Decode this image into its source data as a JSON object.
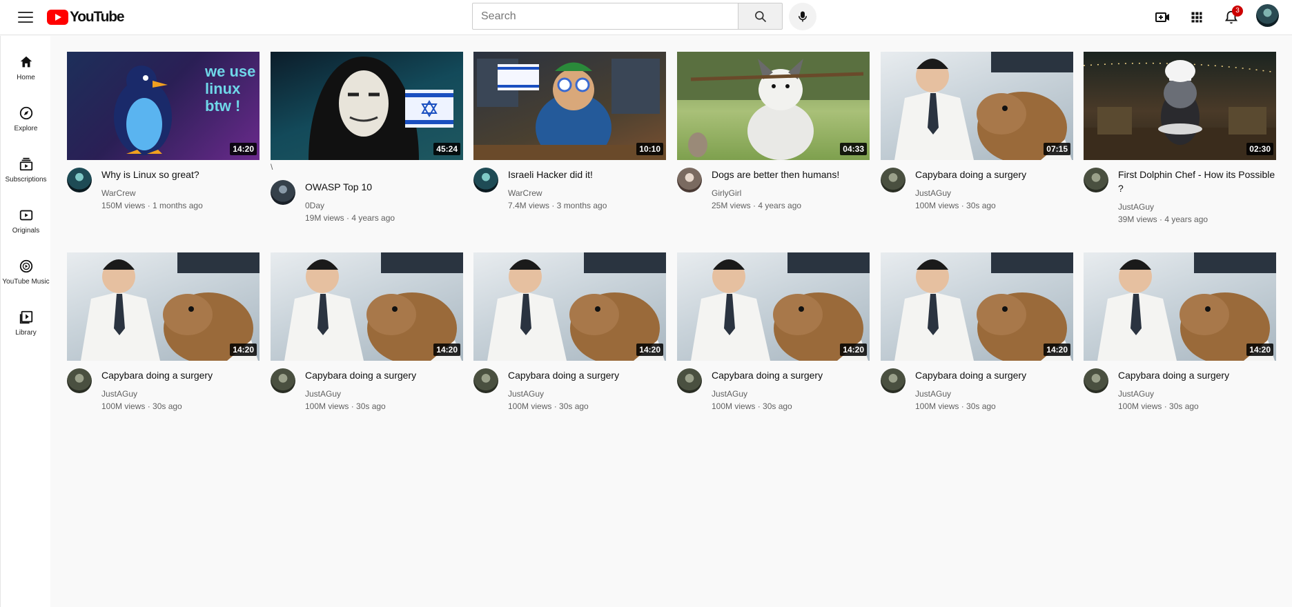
{
  "header": {
    "logo_text": "YouTube",
    "search_placeholder": "Search",
    "notification_count": "3"
  },
  "sidebar": {
    "items": [
      {
        "label": "Home",
        "icon": "home-icon"
      },
      {
        "label": "Explore",
        "icon": "compass-icon"
      },
      {
        "label": "Subscriptions",
        "icon": "subscriptions-icon"
      },
      {
        "label": "Originals",
        "icon": "originals-icon"
      },
      {
        "label": "YouTube Music",
        "icon": "music-icon"
      },
      {
        "label": "Library",
        "icon": "library-icon"
      }
    ]
  },
  "videos": [
    {
      "title": "Why is Linux so great?",
      "channel": "WarCrew",
      "meta": "150M views · 1 months ago",
      "duration": "14:20",
      "thumb_text": "we use linux btw !"
    },
    {
      "title": "OWASP Top 10",
      "channel": "0Day",
      "meta": "19M views · 4 years ago",
      "duration": "45:24",
      "stray": "\\"
    },
    {
      "title": "Israeli Hacker did it!",
      "channel": "WarCrew",
      "meta": "7.4M views · 3 months ago",
      "duration": "10:10"
    },
    {
      "title": "Dogs are better then humans!",
      "channel": "GirlyGirl",
      "meta": "25M views · 4 years ago",
      "duration": "04:33"
    },
    {
      "title": "Capybara doing a surgery",
      "channel": "JustAGuy",
      "meta": "100M views · 30s ago",
      "duration": "07:15"
    },
    {
      "title": "First Dolphin Chef - How its Possible ?",
      "channel": "JustAGuy",
      "meta": "39M views · 4 years ago",
      "duration": "02:30"
    },
    {
      "title": "Capybara doing a surgery",
      "channel": "JustAGuy",
      "meta": "100M views · 30s ago",
      "duration": "14:20"
    },
    {
      "title": "Capybara doing a surgery",
      "channel": "JustAGuy",
      "meta": "100M views · 30s ago",
      "duration": "14:20"
    },
    {
      "title": "Capybara doing a surgery",
      "channel": "JustAGuy",
      "meta": "100M views · 30s ago",
      "duration": "14:20"
    },
    {
      "title": "Capybara doing a surgery",
      "channel": "JustAGuy",
      "meta": "100M views · 30s ago",
      "duration": "14:20"
    },
    {
      "title": "Capybara doing a surgery",
      "channel": "JustAGuy",
      "meta": "100M views · 30s ago",
      "duration": "14:20"
    },
    {
      "title": "Capybara doing a surgery",
      "channel": "JustAGuy",
      "meta": "100M views · 30s ago",
      "duration": "14:20"
    }
  ],
  "colors": {
    "brand_red": "#ff0000",
    "badge_red": "#cc0000",
    "background": "#f9f9f9"
  }
}
